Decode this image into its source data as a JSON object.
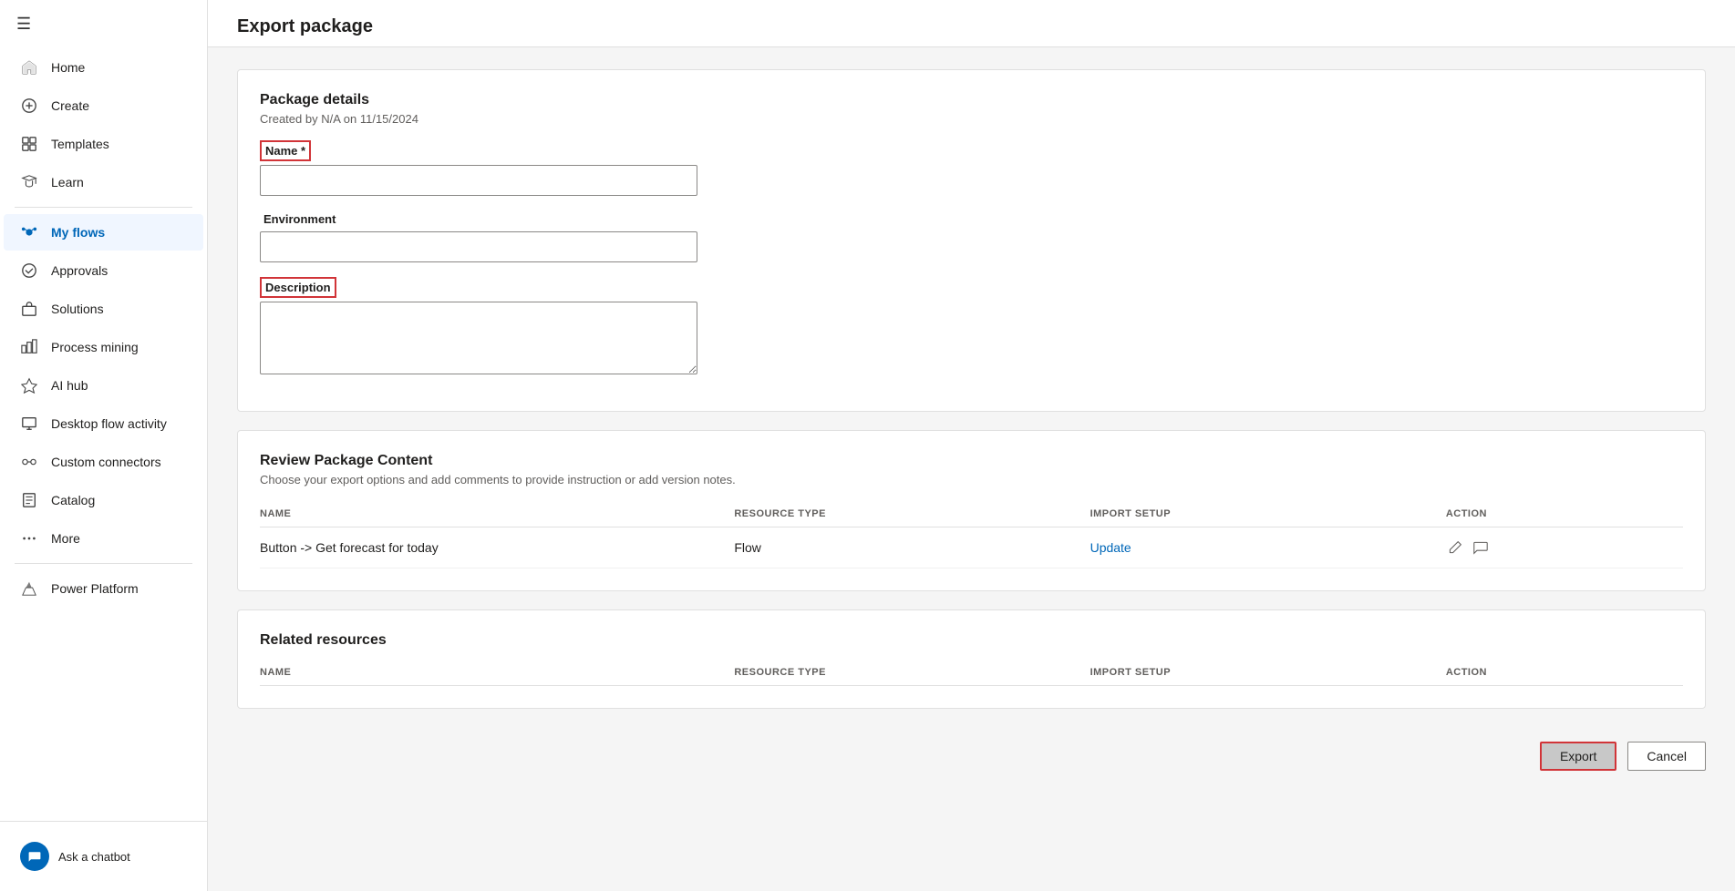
{
  "page": {
    "title": "Export package"
  },
  "sidebar": {
    "hamburger_icon": "☰",
    "items": [
      {
        "id": "home",
        "label": "Home",
        "icon": "home",
        "active": false
      },
      {
        "id": "create",
        "label": "Create",
        "icon": "create",
        "active": false
      },
      {
        "id": "templates",
        "label": "Templates",
        "icon": "templates",
        "active": false
      },
      {
        "id": "learn",
        "label": "Learn",
        "icon": "learn",
        "active": false
      },
      {
        "id": "my-flows",
        "label": "My flows",
        "icon": "myflows",
        "active": true
      },
      {
        "id": "approvals",
        "label": "Approvals",
        "icon": "approvals",
        "active": false
      },
      {
        "id": "solutions",
        "label": "Solutions",
        "icon": "solutions",
        "active": false
      },
      {
        "id": "process-mining",
        "label": "Process mining",
        "icon": "process",
        "active": false
      },
      {
        "id": "ai-hub",
        "label": "AI hub",
        "icon": "ai",
        "active": false
      },
      {
        "id": "desktop-flow-activity",
        "label": "Desktop flow activity",
        "icon": "desktop",
        "active": false
      },
      {
        "id": "custom-connectors",
        "label": "Custom connectors",
        "icon": "connectors",
        "active": false
      },
      {
        "id": "catalog",
        "label": "Catalog",
        "icon": "catalog",
        "active": false
      },
      {
        "id": "more",
        "label": "More",
        "icon": "more",
        "active": false
      }
    ],
    "power_platform_label": "Power Platform",
    "chatbot_label": "Ask a chatbot"
  },
  "package_details": {
    "section_title": "Package details",
    "created_info": "Created by N/A on 11/15/2024",
    "name_label": "Name *",
    "name_placeholder": "",
    "environment_label": "Environment",
    "environment_placeholder": "",
    "description_label": "Description",
    "description_placeholder": ""
  },
  "review_package": {
    "section_title": "Review Package Content",
    "subtitle": "Choose your export options and add comments to provide instruction or add version notes.",
    "columns": {
      "name": "NAME",
      "resource_type": "RESOURCE TYPE",
      "import_setup": "IMPORT SETUP",
      "action": "ACTION"
    },
    "rows": [
      {
        "name": "Button -> Get forecast for today",
        "resource_type": "Flow",
        "import_setup": "Update",
        "import_setup_link": true
      }
    ]
  },
  "related_resources": {
    "section_title": "Related resources",
    "columns": {
      "name": "NAME",
      "resource_type": "RESOURCE TYPE",
      "import_setup": "IMPORT SETUP",
      "action": "ACTION"
    }
  },
  "footer": {
    "export_label": "Export",
    "cancel_label": "Cancel"
  }
}
